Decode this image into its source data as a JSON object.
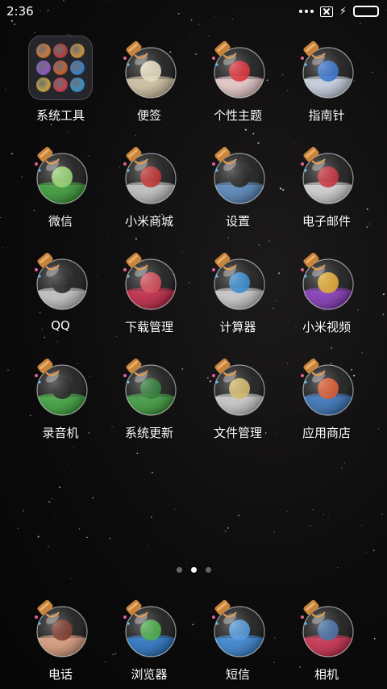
{
  "status_bar": {
    "time": "2:36",
    "battery_level": 1.0,
    "charging": true,
    "no_sim": true
  },
  "home": {
    "apps": [
      {
        "label": "系统工具",
        "kind": "folder",
        "icon": "folder-icon"
      },
      {
        "label": "便签",
        "kind": "bottle",
        "icon": "notes-scroll-icon",
        "liquid": "#d9c8a8",
        "accent": "#f3e8c8"
      },
      {
        "label": "个性主题",
        "kind": "bottle",
        "icon": "hearts-theme-icon",
        "liquid": "#f0d0d0",
        "accent": "#e8202a"
      },
      {
        "label": "指南针",
        "kind": "bottle",
        "icon": "compass-icon",
        "liquid": "#cfd8e8",
        "accent": "#2a6fd8"
      },
      {
        "label": "微信",
        "kind": "bottle",
        "icon": "wechat-icon",
        "liquid": "#3ea03a",
        "accent": "#9ae070"
      },
      {
        "label": "小米商城",
        "kind": "bottle",
        "icon": "circus-tent-icon",
        "liquid": "#c8c8c8",
        "accent": "#c82020"
      },
      {
        "label": "设置",
        "kind": "bottle",
        "icon": "cracked-glass-settings-icon",
        "liquid": "#5a8ac0",
        "accent": "#111111"
      },
      {
        "label": "电子邮件",
        "kind": "bottle",
        "icon": "envelope-icon",
        "liquid": "#d8d8d8",
        "accent": "#d02030"
      },
      {
        "label": "QQ",
        "kind": "bottle",
        "icon": "qq-penguin-icon",
        "liquid": "#c8c8c8",
        "accent": "#111111"
      },
      {
        "label": "下载管理",
        "kind": "bottle",
        "icon": "mushroom-download-icon",
        "liquid": "#c82848",
        "accent": "#e04050"
      },
      {
        "label": "计算器",
        "kind": "bottle",
        "icon": "calculator-symbols-icon",
        "liquid": "#d0d0d0",
        "accent": "#2a8ad8"
      },
      {
        "label": "小米视频",
        "kind": "bottle",
        "icon": "video-play-icon",
        "liquid": "#8a3ac0",
        "accent": "#f0b020"
      },
      {
        "label": "录音机",
        "kind": "bottle",
        "icon": "mustache-recorder-icon",
        "liquid": "#40a840",
        "accent": "#111111"
      },
      {
        "label": "系统更新",
        "kind": "bottle",
        "icon": "refresh-update-icon",
        "liquid": "#40a040",
        "accent": "#1f7a2a"
      },
      {
        "label": "文件管理",
        "kind": "bottle",
        "icon": "file-folder-icon",
        "liquid": "#d0d0d0",
        "accent": "#e0c060"
      },
      {
        "label": "应用商店",
        "kind": "bottle",
        "icon": "koi-fish-store-icon",
        "liquid": "#3a78c0",
        "accent": "#e85020"
      }
    ],
    "page_count": 3,
    "current_page": 2
  },
  "dock": {
    "apps": [
      {
        "label": "电话",
        "icon": "phone-dial-icon",
        "liquid": "#e0a080",
        "accent": "#7a2a1a"
      },
      {
        "label": "浏览器",
        "icon": "browser-leaf-icon",
        "liquid": "#2a78c8",
        "accent": "#40b040"
      },
      {
        "label": "短信",
        "icon": "chat-bubble-icon",
        "liquid": "#3a88d8",
        "accent": "#4a9ae8"
      },
      {
        "label": "相机",
        "icon": "eye-camera-icon",
        "liquid": "#d03050",
        "accent": "#3a6aa8"
      }
    ]
  }
}
